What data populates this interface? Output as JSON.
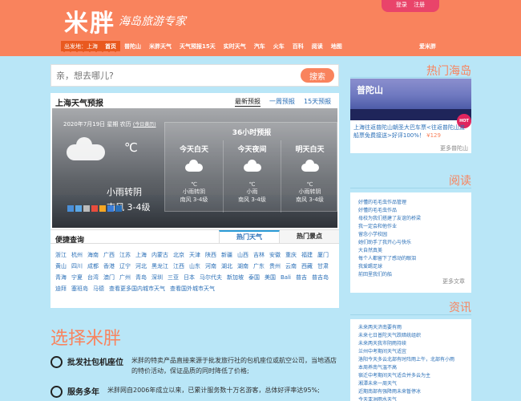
{
  "header": {
    "logo": "米胖",
    "slogan": "海岛旅游专家",
    "login": "登录",
    "register": "注册",
    "origin": "出发地：上海",
    "nav": [
      "首页",
      "普陀山",
      "米胖天气",
      "天气预报15天",
      "实时天气",
      "汽车",
      "火车",
      "百科",
      "阅读",
      "地图"
    ],
    "nav_right": "爱米胖"
  },
  "search": {
    "placeholder": "亲，想去哪儿?",
    "button": "搜索"
  },
  "weather": {
    "title": "上海天气预报",
    "tabs": [
      "最新预报",
      "一周预报",
      "15天预报"
    ],
    "date": "2020年7月19日 星期 农历",
    "date_link": "(今日黄历)",
    "temp_unit": "℃",
    "condition": "小雨转阴",
    "wind": "南风 3-4级",
    "forecast_title": "36小时预报",
    "forecast": [
      {
        "name": "今天白天",
        "temp": "℃",
        "desc": "小雨转阴",
        "wind": "南风 3-4级"
      },
      {
        "name": "今天夜间",
        "temp": "℃",
        "desc": "小雨",
        "wind": "南风 3-4级"
      },
      {
        "name": "明天白天",
        "temp": "℃",
        "desc": "小雨转阴",
        "wind": "南风 3-4级"
      }
    ]
  },
  "quick": {
    "title": "便捷查询",
    "tab_hot_weather": "热门天气",
    "tab_hot_spots": "热门景点",
    "cities": [
      "浙江",
      "杭州",
      "海南",
      "广西",
      "江苏",
      "上海",
      "内蒙古",
      "北京",
      "天津",
      "陕西",
      "新疆",
      "山西",
      "吉林",
      "安徽",
      "重庆",
      "福建",
      "厦门",
      "黄山",
      "四川",
      "成都",
      "香港",
      "辽宁",
      "河北",
      "黑龙江",
      "江西",
      "山东",
      "河南",
      "湖北",
      "湖南",
      "广东",
      "贵州",
      "云南",
      "西藏",
      "甘肃",
      "青海",
      "宁夏",
      "台湾",
      "澳门",
      "广州",
      "青岛",
      "深圳",
      "三亚",
      "日本",
      "马尔代夫",
      "新加坡",
      "泰国",
      "美国",
      "Bali",
      "普吉",
      "普吉岛",
      "迪拜",
      "塞班岛",
      "马德"
    ],
    "more_domestic": "查看更多国内城市天气",
    "more_intl": "查看国外城市天气"
  },
  "choose": {
    "title": "选择米胖",
    "features": [
      {
        "icon": "eye-icon",
        "title": "批发社包机座位",
        "desc": "米胖的特卖产品直接来源于批发旅行社的包机座位或航空公司，当地酒店的特价活动，保证品质的同时降低了价格;"
      },
      {
        "icon": "smile-icon",
        "title": "服务多年",
        "desc": "米胖网自2006年成立以来，已累计服务数十万名游客，总体好评率达95%;"
      }
    ]
  },
  "side": {
    "hot_title": "热门海岛",
    "hot_name": "普陀山",
    "hot_badge": "HOT",
    "hot_desc": "上海往返普陀山朝圣大巴车票<往返普陀山渡船票免费接送>好评100%！",
    "hot_price": "¥129",
    "hot_more": "更多普陀山",
    "read_title": "阅读",
    "read_items": [
      "好懂的毛毛虫作品管理",
      "好懂的毛毛虫作品",
      "母校为我们搭建了友谊的桥梁",
      "我一定会和他作业",
      "留念小学校园",
      "她们助手了我开心与快乐",
      "大自然真美",
      "每个人都留下了感动的眼泪",
      "我爱踢足球",
      "前回里我们的船"
    ],
    "read_more": "更多文章",
    "info_title": "资讯",
    "info_items": [
      "未来两天济南要有雨",
      "未来七日普陀天气跌暗统组织",
      "未来两天我市阴雨持续",
      "兰州中考期间天气适宜",
      "洛阳今天多云北部有时阵雨上午，北部有小雨",
      "本周养南气温不高",
      "宿迁中考期间天气适合并多云为主",
      "湘潭未来一周天气",
      "近期南部有强降雨未来暂停冰",
      "今天亚洲雨水天气"
    ]
  }
}
